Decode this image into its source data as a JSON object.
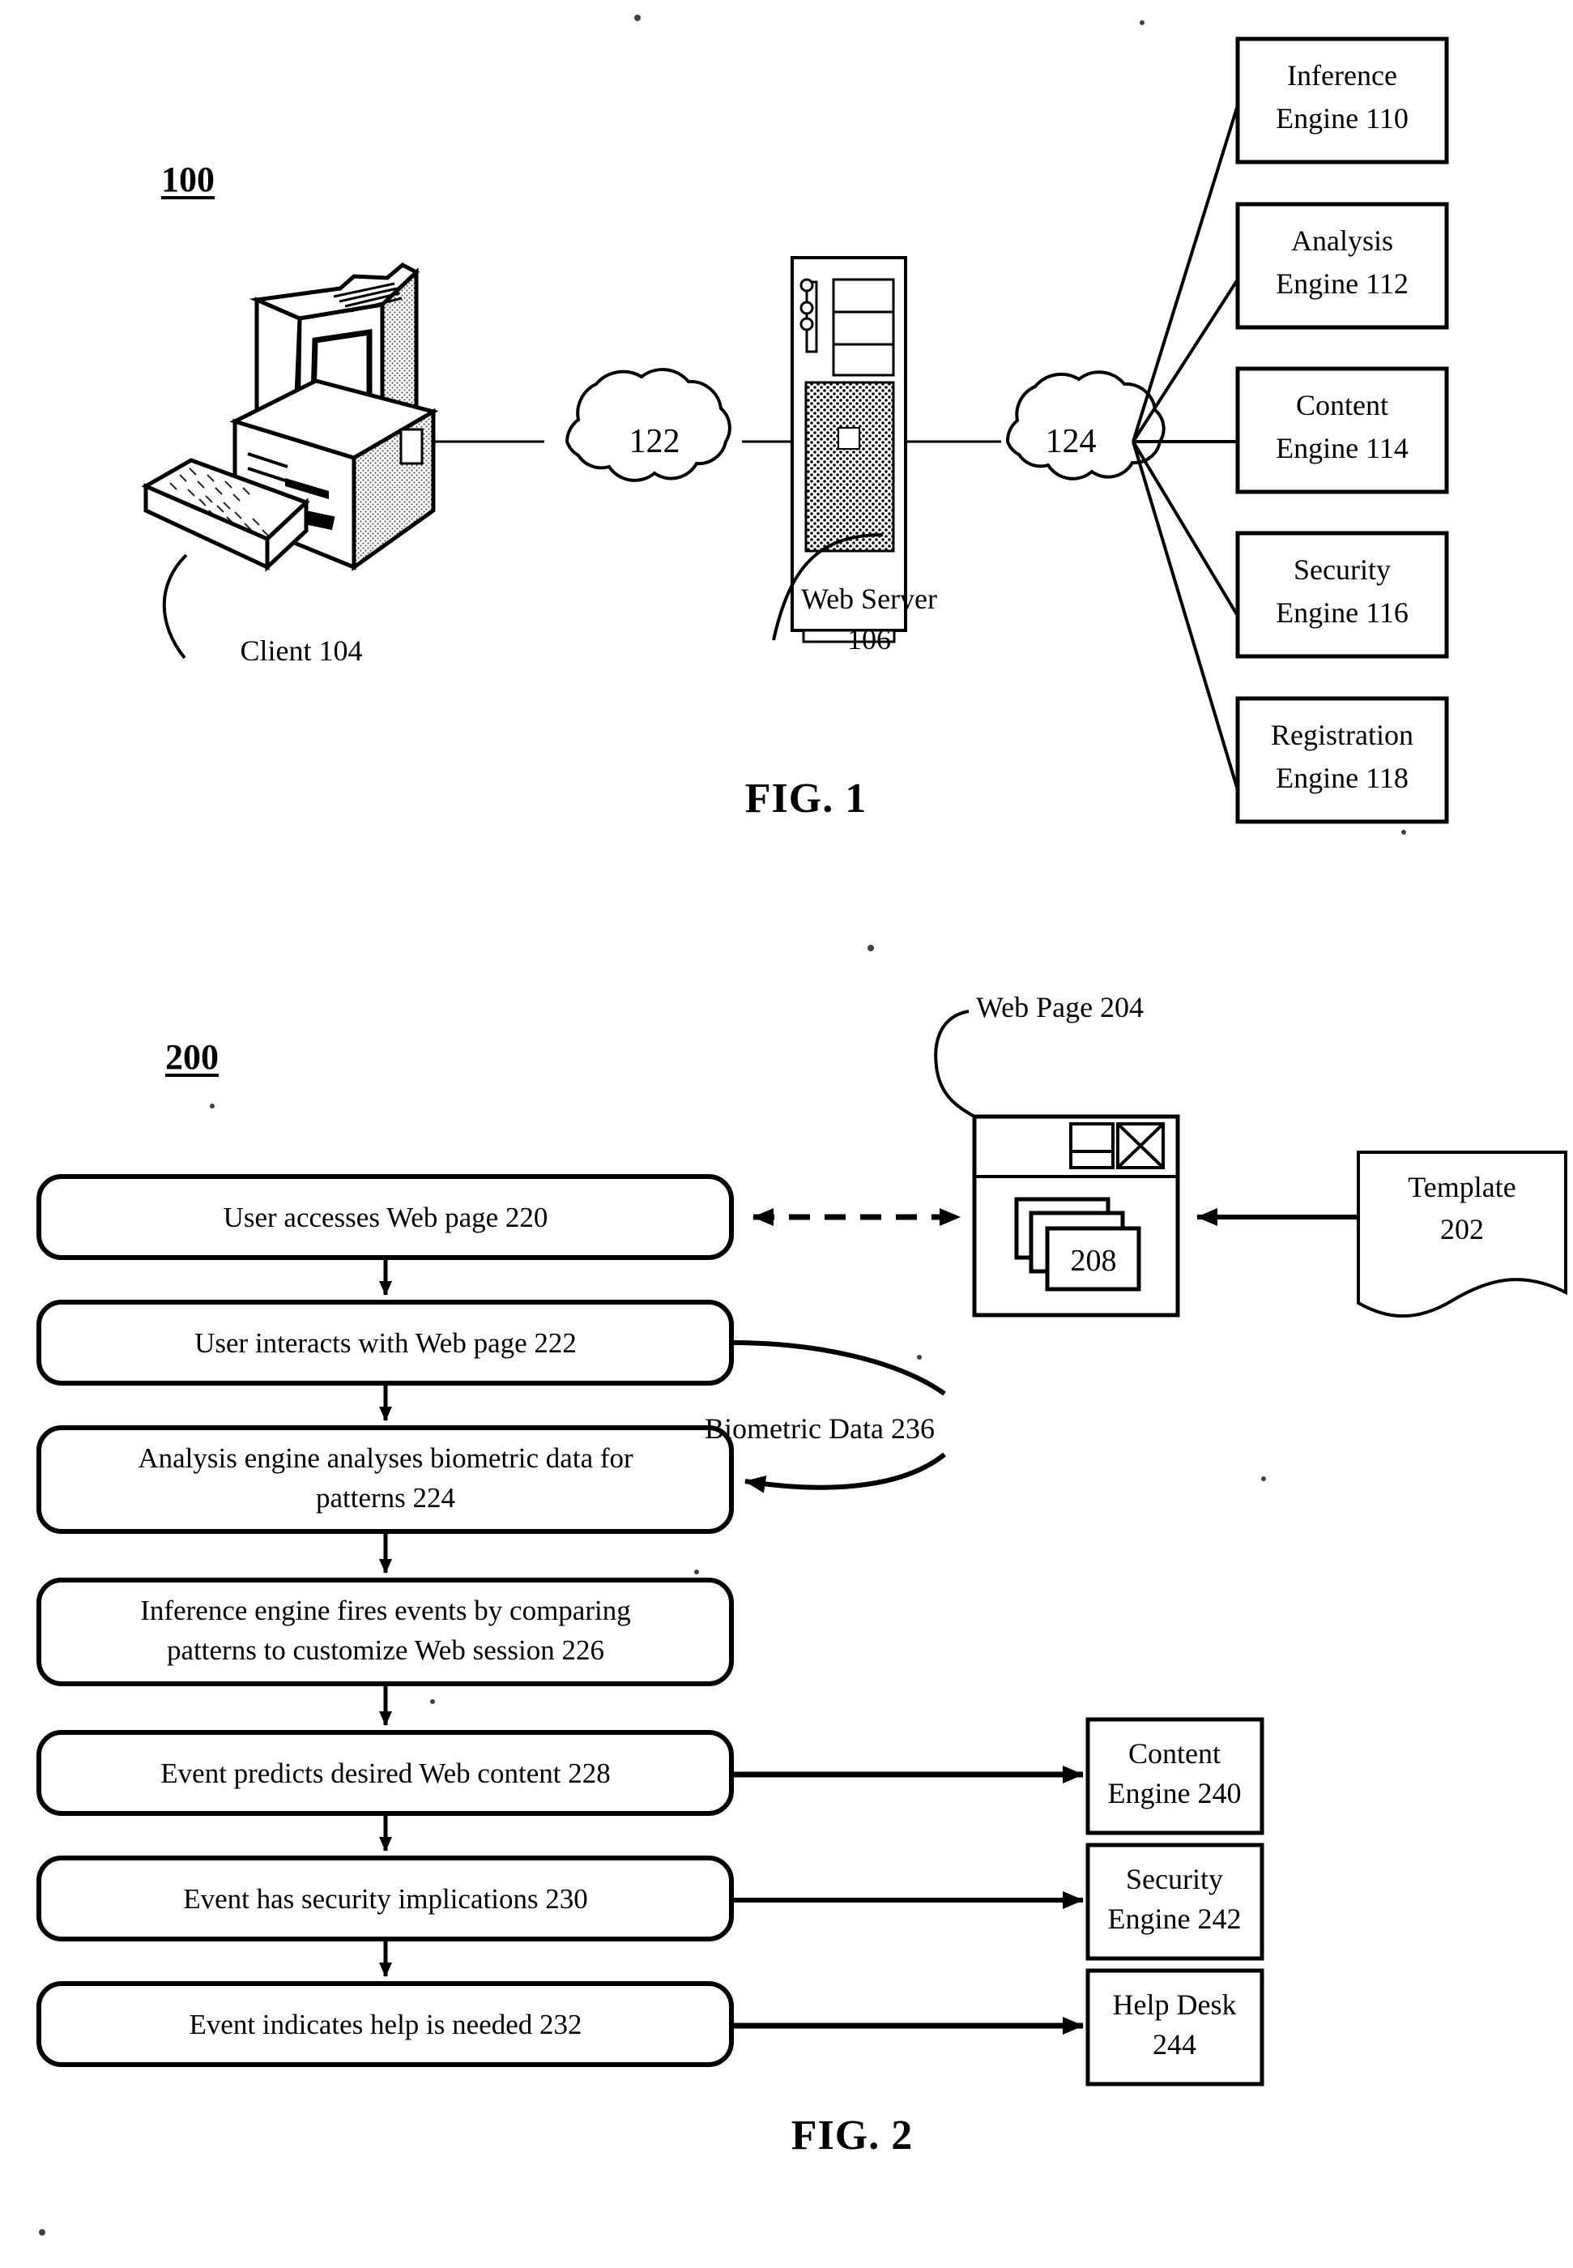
{
  "document": {
    "type": "patent-figure-sheet",
    "figures": [
      "FIG. 1",
      "FIG. 2"
    ]
  },
  "fig1": {
    "caption": "FIG. 1",
    "ref_label": "100",
    "client": {
      "label": "Client 104",
      "icon": "desktop-computer-icon"
    },
    "network_1": {
      "label": "122",
      "icon": "cloud-icon"
    },
    "web_server": {
      "label_line1": "Web Server",
      "label_line2": "106",
      "icon": "server-tower-icon"
    },
    "network_2": {
      "label": "124",
      "icon": "cloud-icon"
    },
    "engines": [
      {
        "line1": "Inference",
        "line2": "Engine 110"
      },
      {
        "line1": "Analysis",
        "line2": "Engine 112"
      },
      {
        "line1": "Content",
        "line2": "Engine 114"
      },
      {
        "line1": "Security",
        "line2": "Engine 116"
      },
      {
        "line1": "Registration",
        "line2": "Engine 118"
      }
    ]
  },
  "fig2": {
    "caption": "FIG. 2",
    "ref_label": "200",
    "web_page": {
      "callout": "Web Page 204",
      "content_label": "208",
      "icon": "browser-window-icon"
    },
    "template": {
      "line1": "Template",
      "line2": "202",
      "icon": "document-sheet-icon"
    },
    "biometric_data": {
      "label": "Biometric Data 236"
    },
    "steps": [
      {
        "lines": [
          "User accesses Web page 220"
        ]
      },
      {
        "lines": [
          "User interacts with Web page 222"
        ]
      },
      {
        "lines": [
          "Analysis engine analyses biometric data for",
          "patterns 224"
        ]
      },
      {
        "lines": [
          "Inference engine fires events by comparing",
          "patterns to customize Web session 226"
        ]
      },
      {
        "lines": [
          "Event predicts desired Web content 228"
        ]
      },
      {
        "lines": [
          "Event has security implications 230"
        ]
      },
      {
        "lines": [
          "Event indicates help is needed 232"
        ]
      }
    ],
    "targets": [
      {
        "line1": "Content",
        "line2": "Engine 240"
      },
      {
        "line1": "Security",
        "line2": "Engine 242"
      },
      {
        "line1": "Help Desk",
        "line2": "244"
      }
    ]
  },
  "colors": {
    "ink": "#000000",
    "paper": "#ffffff"
  }
}
